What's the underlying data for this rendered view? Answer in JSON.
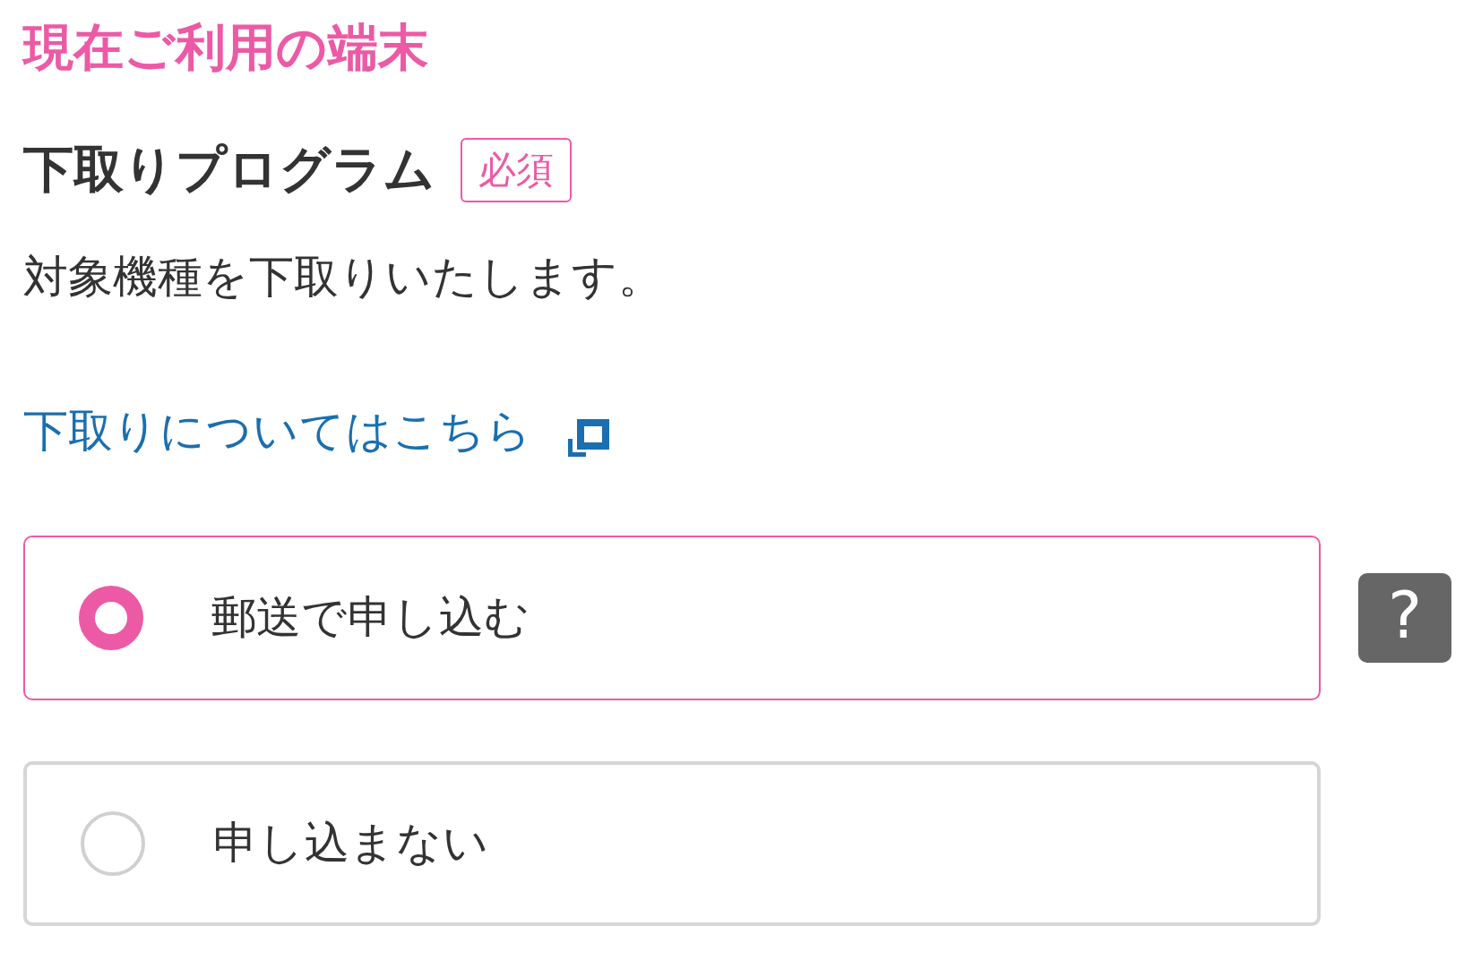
{
  "section_title": "現在ご利用の端末",
  "heading": {
    "text": "下取りプログラム",
    "badge": "必須"
  },
  "description": "対象機種を下取りいたします。",
  "link": {
    "text": "下取りについてはこちら"
  },
  "options": [
    {
      "label": "郵送で申し込む",
      "selected": true
    },
    {
      "label": "申し込まない",
      "selected": false
    }
  ],
  "help_button": {
    "label": "?"
  }
}
